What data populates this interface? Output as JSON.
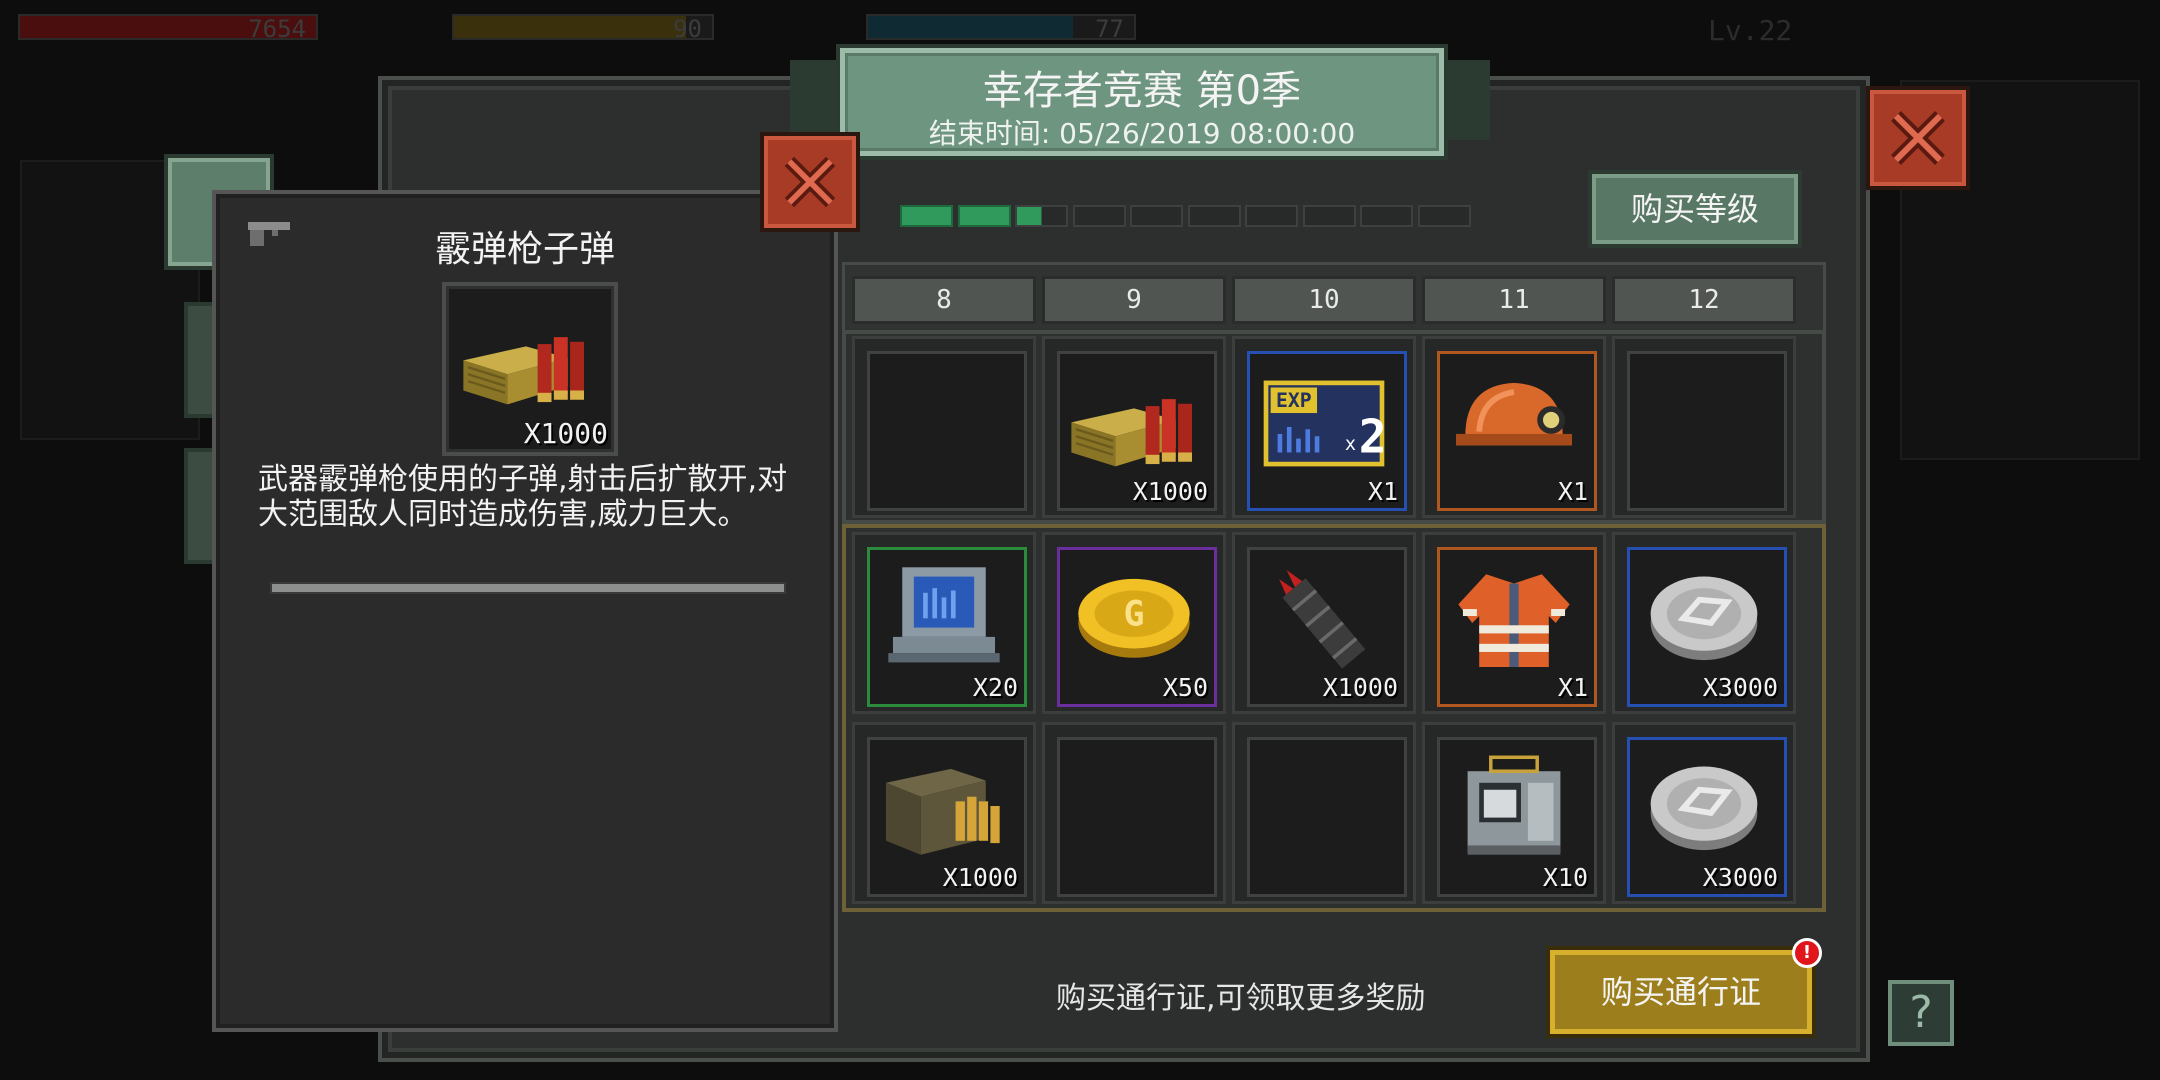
{
  "hud": {
    "health_value": "7654",
    "energy_value": "90",
    "water_value": "77",
    "level_text": "Lv.22",
    "colors": {
      "health": "#6b1212",
      "energy": "#5a4a12",
      "water": "#123d4d"
    }
  },
  "season": {
    "title": "幸存者竞赛 第0季",
    "end_time": "结束时间: 05/26/2019 08:00:00",
    "progress_segments_total": 10,
    "progress_filled": 2.5,
    "accent": "#2f9a5c"
  },
  "buttons": {
    "buy_level": "购买等级",
    "buy_pass": "购买通行证",
    "help": "?",
    "pass_alert_badge": "!"
  },
  "footer": {
    "hint": "购买通行证,可领取更多奖励"
  },
  "levels": {
    "columns": [
      "8",
      "9",
      "10",
      "11",
      "12"
    ],
    "free_row": [
      {
        "icon": "empty-slot",
        "qty": ""
      },
      {
        "icon": "shotgun-ammo-crate-icon",
        "qty": "X1000"
      },
      {
        "icon": "exp-boost-card-icon",
        "qty": "X1"
      },
      {
        "icon": "mining-helmet-icon",
        "qty": "X1"
      },
      {
        "icon": "empty-slot",
        "qty": ""
      }
    ],
    "pass_row_1": [
      {
        "icon": "blueprint-device-icon",
        "qty": "X20"
      },
      {
        "icon": "gold-coin-icon",
        "qty": "X50"
      },
      {
        "icon": "arrow-quiver-icon",
        "qty": "X1000"
      },
      {
        "icon": "hi-vis-jacket-icon",
        "qty": "X1"
      },
      {
        "icon": "silver-coin-icon",
        "qty": "X3000"
      }
    ],
    "pass_row_2": [
      {
        "icon": "rifle-ammo-crate-icon",
        "qty": "X1000"
      },
      {
        "icon": "empty-slot",
        "qty": ""
      },
      {
        "icon": "empty-slot",
        "qty": ""
      },
      {
        "icon": "generator-box-icon",
        "qty": "X10"
      },
      {
        "icon": "silver-coin-icon",
        "qty": "X3000"
      }
    ]
  },
  "detail": {
    "type_icon": "pistol-icon",
    "name": "霰弹枪子弹",
    "qty": "X1000",
    "description": "武器霰弹枪使用的子弹,射击后扩散开,对大范围敌人同时造成伤害,威力巨大。"
  }
}
